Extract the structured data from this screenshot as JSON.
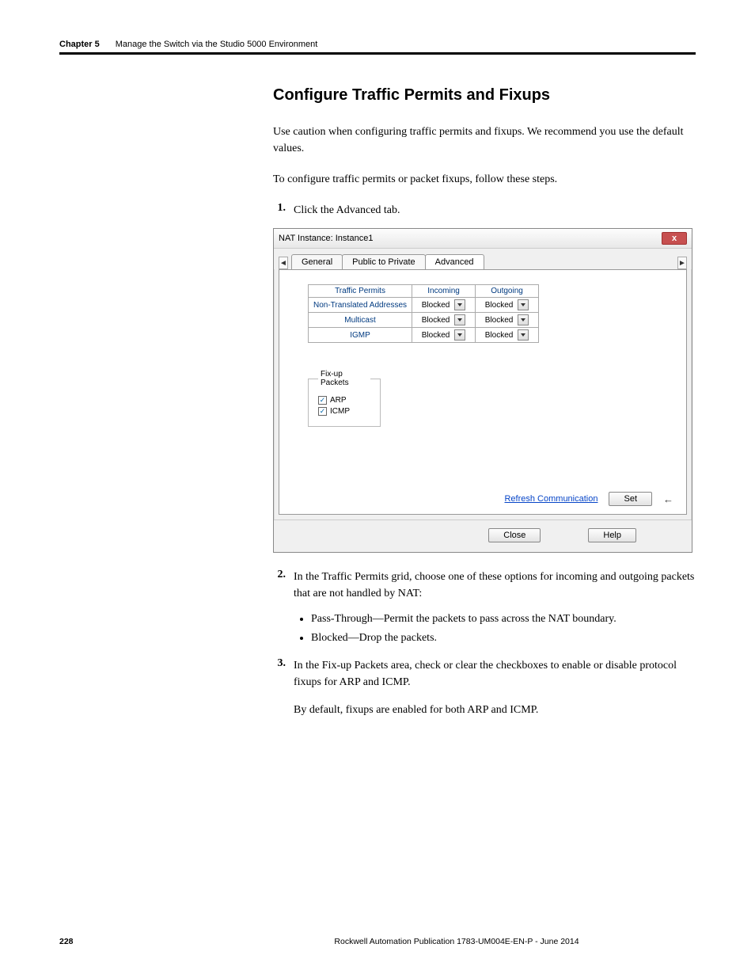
{
  "header": {
    "chapter_label": "Chapter 5",
    "chapter_title": "Manage the Switch via the Studio 5000 Environment"
  },
  "section": {
    "heading": "Configure Traffic Permits and Fixups",
    "intro1": "Use caution when configuring traffic permits and fixups. We recommend you use the default values.",
    "intro2": "To configure traffic permits or packet fixups, follow these steps."
  },
  "steps": {
    "s1": {
      "num": "1.",
      "text": "Click the Advanced tab."
    },
    "s2": {
      "num": "2.",
      "text": "In the Traffic Permits grid, choose one of these options for incoming and outgoing packets that are not handled by NAT:",
      "b1": "Pass-Through—Permit the packets to pass across the NAT boundary.",
      "b2": "Blocked—Drop the packets."
    },
    "s3": {
      "num": "3.",
      "text": "In the Fix-up Packets area, check or clear the checkboxes to enable or disable protocol fixups for ARP and ICMP.",
      "after": "By default, fixups are enabled for both ARP and ICMP."
    }
  },
  "dialog": {
    "title": "NAT Instance: Instance1",
    "close_glyph": "x",
    "tab_left_arrow": "◄",
    "tab_right_arrow": "►",
    "tabs": {
      "general": "General",
      "ptp": "Public to Private",
      "advanced": "Advanced"
    },
    "table": {
      "h_traffic": "Traffic Permits",
      "h_incoming": "Incoming",
      "h_outgoing": "Outgoing",
      "rows": {
        "r1": {
          "label": "Non-Translated Addresses",
          "in": "Blocked",
          "out": "Blocked"
        },
        "r2": {
          "label": "Multicast",
          "in": "Blocked",
          "out": "Blocked"
        },
        "r3": {
          "label": "IGMP",
          "in": "Blocked",
          "out": "Blocked"
        }
      }
    },
    "fixup": {
      "legend": "Fix-up Packets",
      "arp": "ARP",
      "icmp": "ICMP",
      "check": "✓"
    },
    "actions": {
      "refresh": "Refresh Communication",
      "set": "Set",
      "back": "←"
    },
    "footer": {
      "close": "Close",
      "help": "Help"
    }
  },
  "page_footer": {
    "page": "228",
    "publication": "Rockwell Automation Publication 1783-UM004E-EN-P - June 2014"
  }
}
